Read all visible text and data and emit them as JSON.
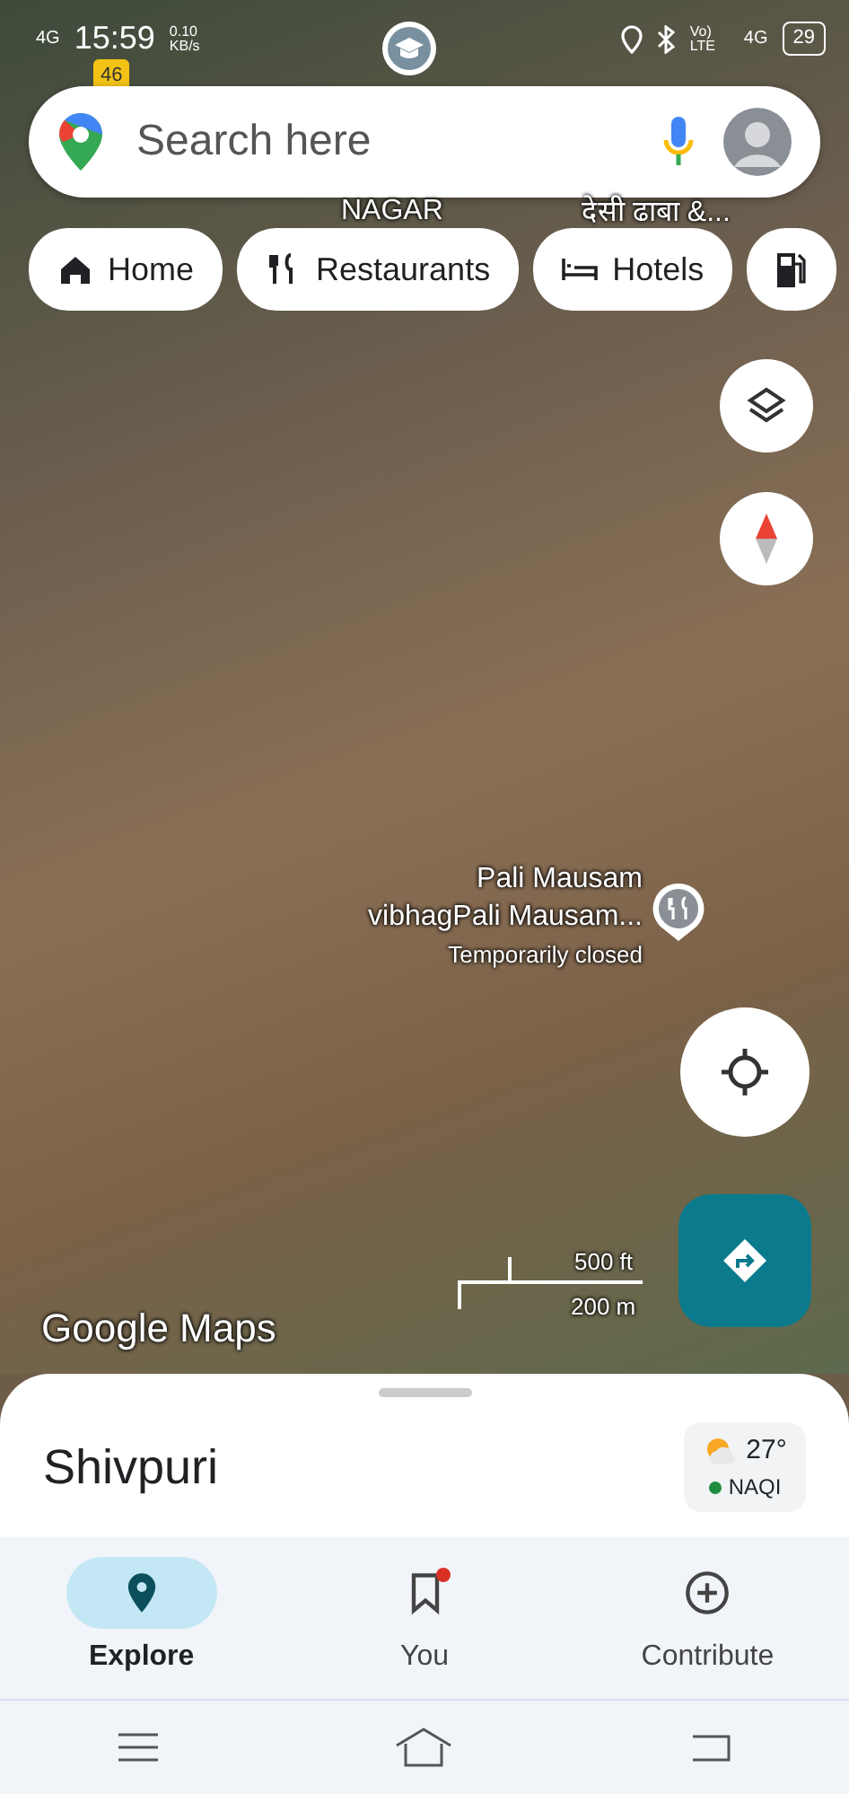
{
  "status_bar": {
    "network_left": "4G",
    "time": "15:59",
    "speed": "0.10 KB/s",
    "volte": "Vo) LTE",
    "network_right": "4G",
    "battery": "29"
  },
  "search": {
    "placeholder": "Search here"
  },
  "chips": [
    {
      "label": "Home"
    },
    {
      "label": "Restaurants"
    },
    {
      "label": "Hotels"
    }
  ],
  "map": {
    "road_shield": "46",
    "area_label": "NAGAR",
    "place_label": "देसी ढाबा &...",
    "poi": {
      "name": "Pali Mausam vibhagPali Mausam...",
      "status": "Temporarily closed"
    },
    "scale": {
      "imperial": "500 ft",
      "metric": "200 m"
    },
    "logo": "Google Maps"
  },
  "sheet": {
    "title": "Shivpuri",
    "weather": {
      "temperature": "27°",
      "aqi": {
        "label": "NAQI",
        "color": "#1e8e3e"
      }
    }
  },
  "bottom_nav": [
    {
      "label": "Explore",
      "selected": true,
      "badge": false
    },
    {
      "label": "You",
      "selected": false,
      "badge": true
    },
    {
      "label": "Contribute",
      "selected": false,
      "badge": false
    }
  ]
}
